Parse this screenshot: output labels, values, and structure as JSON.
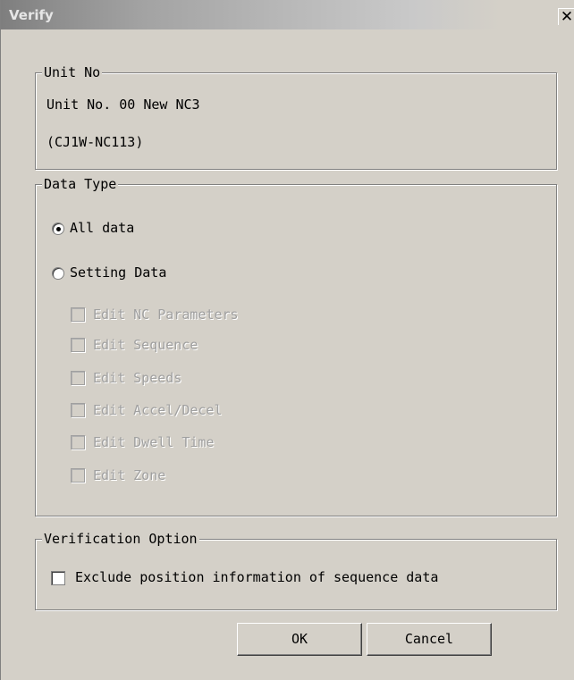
{
  "window": {
    "title": "Verify",
    "close_glyph": "✕"
  },
  "unit_group": {
    "legend": "Unit No",
    "line1": "Unit No. 00 New NC3",
    "line2": "(CJ1W-NC113)"
  },
  "data_type_group": {
    "legend": "Data Type",
    "options": [
      {
        "label": "All data",
        "selected": true
      },
      {
        "label": "Setting Data",
        "selected": false
      }
    ],
    "sub_options": [
      {
        "label": "Edit NC Parameters",
        "checked": false,
        "enabled": false
      },
      {
        "label": "Edit Sequence",
        "checked": false,
        "enabled": false
      },
      {
        "label": "Edit Speeds",
        "checked": false,
        "enabled": false
      },
      {
        "label": "Edit Accel/Decel",
        "checked": false,
        "enabled": false
      },
      {
        "label": "Edit Dwell Time",
        "checked": false,
        "enabled": false
      },
      {
        "label": "Edit Zone",
        "checked": false,
        "enabled": false
      }
    ]
  },
  "verification_group": {
    "legend": "Verification Option",
    "option_label": "Exclude position information of sequence data",
    "checked": false
  },
  "buttons": {
    "ok": "OK",
    "cancel": "Cancel"
  },
  "colors": {
    "dialog_bg": "#d4d0c8",
    "disabled_text": "#a0a0a0"
  }
}
